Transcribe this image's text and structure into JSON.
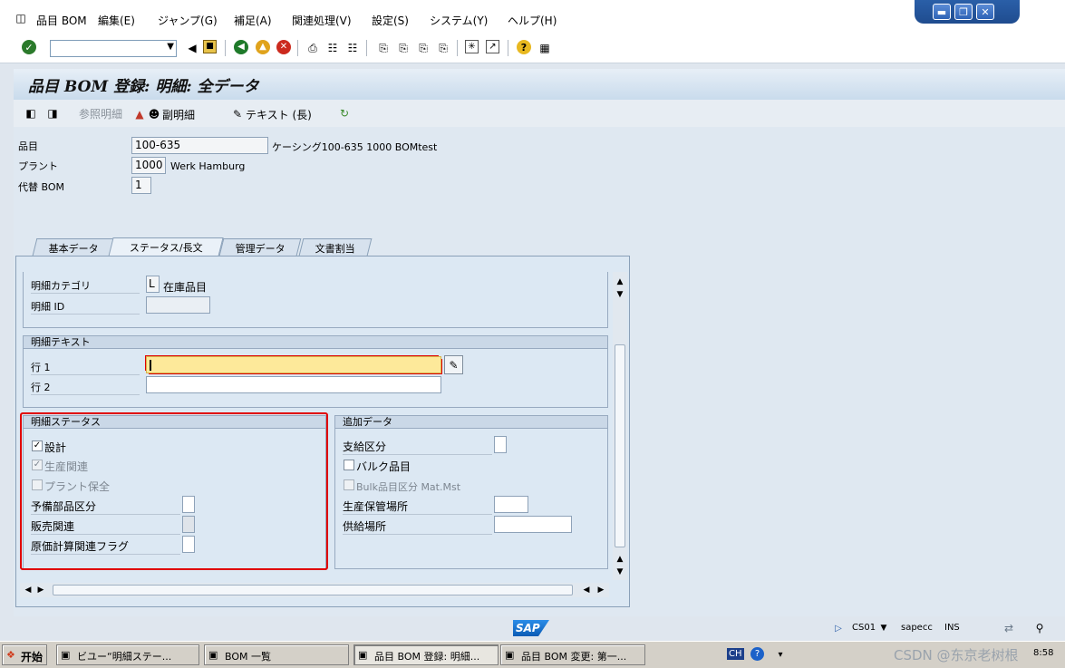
{
  "menu": {
    "items": [
      "品目 BOM",
      "編集(E)",
      "ジャンプ(G)",
      "補足(A)",
      "関連処理(V)",
      "設定(S)",
      "システム(Y)",
      "ヘルプ(H)"
    ]
  },
  "header": {
    "title": "品目 BOM 登録: 明細: 全データ"
  },
  "app_toolbar": {
    "ref_detail": "参照明細",
    "sub_detail": "副明細",
    "text_long": "テキスト (長)"
  },
  "fields": {
    "material_label": "品目",
    "material_value": "100-635",
    "material_desc": "ケーシング100-635 1000 BOMtest",
    "plant_label": "プラント",
    "plant_value": "1000",
    "plant_desc": "Werk Hamburg",
    "alt_bom_label": "代替 BOM",
    "alt_bom_value": "1"
  },
  "tabs": [
    "基本データ",
    "ステータス/長文",
    "管理データ",
    "文書割当"
  ],
  "item": {
    "category_label": "明細カテゴリ",
    "category_value": "L",
    "category_desc": "在庫品目",
    "id_label": "明細 ID"
  },
  "item_text": {
    "title": "明細テキスト",
    "line1_label": "行 1",
    "line2_label": "行 2"
  },
  "item_status": {
    "title": "明細ステータス",
    "design": "設計",
    "production": "生産関連",
    "plant_maint": "プラント保全",
    "spare_part": "予備部品区分",
    "sales": "販売関連",
    "costing": "原価計算関連フラグ"
  },
  "additional": {
    "title": "追加データ",
    "supply_type": "支給区分",
    "bulk": "バルク品目",
    "bulk_mm": "Bulk品目区分 Mat.Mst",
    "prod_storage": "生産保管場所",
    "supply_area": "供給場所"
  },
  "status": {
    "tcode": "CS01",
    "system": "sapecc",
    "mode": "INS",
    "sap_logo": "SAP"
  },
  "taskbar": {
    "start": "开始",
    "tasks": [
      "ビユー“明細ステー...",
      "BOM 一覧",
      "品目 BOM 登録: 明細...",
      "品目 BOM 変更: 第一..."
    ],
    "lang": "CH",
    "time": "8:58"
  },
  "watermark": "CSDN @东京老树根",
  "colors": {
    "highlight_border": "#e00000",
    "active_input": "#fde99a",
    "title_gradient": "#c9dbec"
  }
}
